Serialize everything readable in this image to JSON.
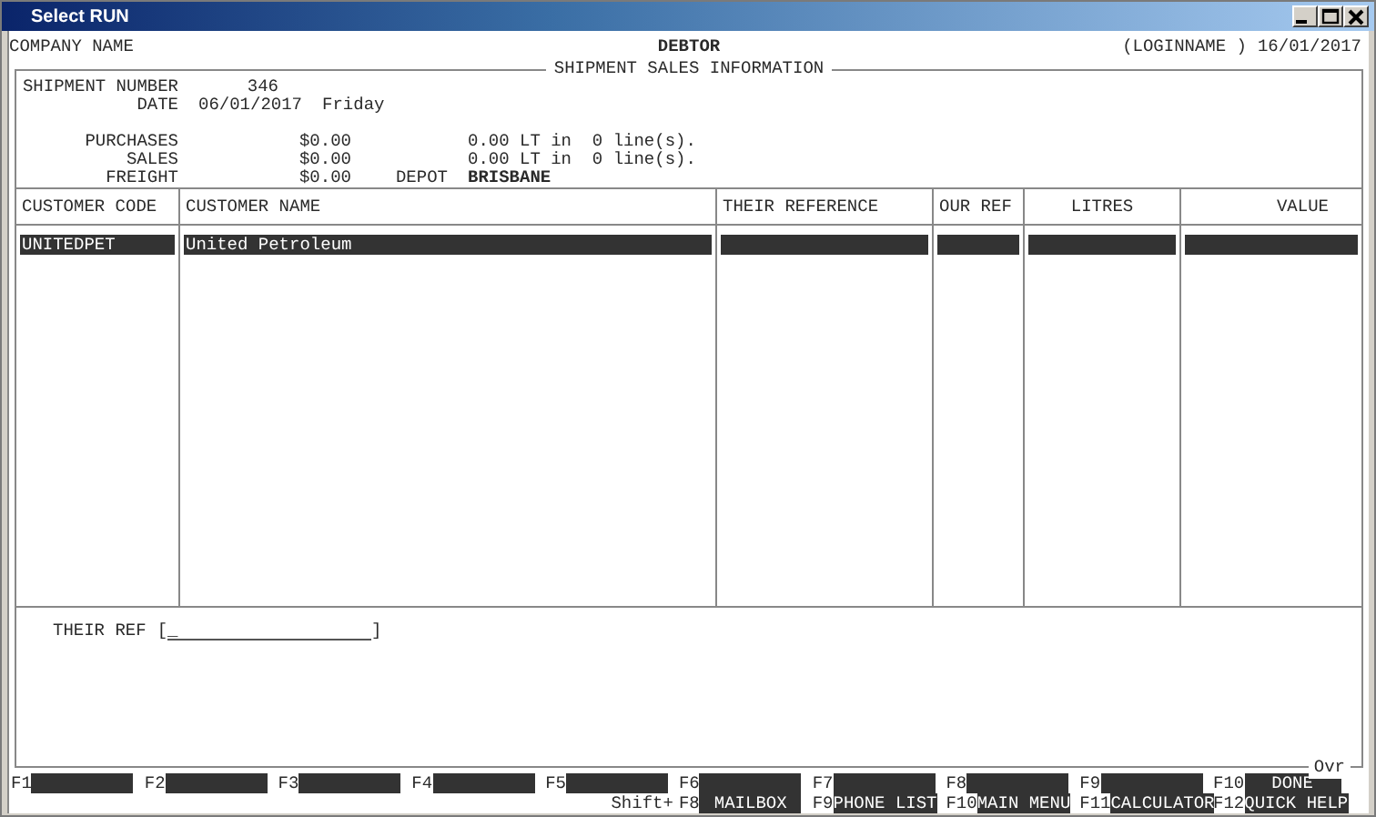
{
  "window": {
    "title": "Select RUN"
  },
  "header": {
    "company": "COMPANY NAME",
    "module": "DEBTOR",
    "user": "(LOGINNAME )",
    "date": "16/01/2017"
  },
  "panel": {
    "title": "SHIPMENT SALES INFORMATION",
    "mode": "Ovr"
  },
  "shipment": {
    "number_label": "SHIPMENT NUMBER",
    "number": "346",
    "date_label": "DATE",
    "date": "06/01/2017",
    "day": "Friday"
  },
  "totals": [
    {
      "kind": "lines",
      "label": "PURCHASES",
      "amount": "$0.00",
      "detail": "0.00 LT in  0 line(s)."
    },
    {
      "kind": "lines",
      "label": "SALES",
      "amount": "$0.00",
      "detail": "0.00 LT in  0 line(s)."
    },
    {
      "kind": "depot",
      "label": "FREIGHT",
      "amount": "$0.00",
      "depot_label": "DEPOT",
      "depot": "BRISBANE"
    }
  ],
  "table": {
    "columns": [
      {
        "label": "CUSTOMER CODE"
      },
      {
        "label": "CUSTOMER NAME"
      },
      {
        "label": "THEIR REFERENCE"
      },
      {
        "label": "OUR REF"
      },
      {
        "label": "LITRES"
      },
      {
        "label": "VALUE"
      }
    ],
    "rows": [
      {
        "code": "UNITEDPET",
        "name": "United Petroleum",
        "selected": true
      }
    ]
  },
  "their_ref": {
    "label": "THEIR REF",
    "open": "[",
    "close": "]",
    "value": "_"
  },
  "function_keys": [
    {
      "key": "F1"
    },
    {
      "key": "F2"
    },
    {
      "key": "F3"
    },
    {
      "key": "F4"
    },
    {
      "key": "F5"
    },
    {
      "key": "F6"
    },
    {
      "key": "F7"
    },
    {
      "key": "F8"
    },
    {
      "key": "F9"
    },
    {
      "key": "F10",
      "label": "DONE"
    }
  ],
  "shift_label": "Shift+",
  "shift_keys": [
    {
      "key": "F8",
      "label": "MAILBOX"
    },
    {
      "key": "F9",
      "label": "PHONE LIST"
    },
    {
      "key": "F10",
      "label": "MAIN MENU"
    },
    {
      "key": "F11",
      "label": "CALCULATOR"
    },
    {
      "key": "F12",
      "label": "QUICK HELP"
    }
  ]
}
